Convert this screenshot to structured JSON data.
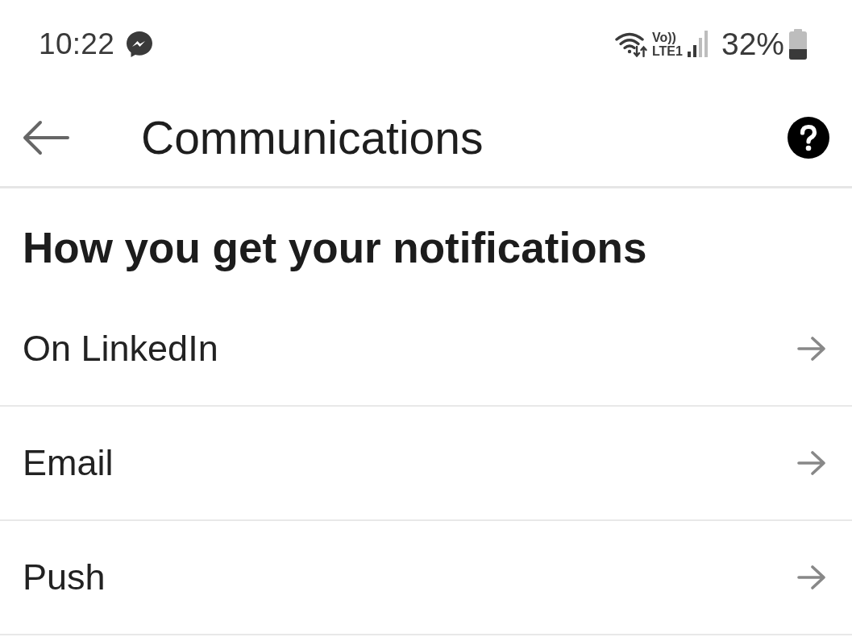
{
  "status_bar": {
    "time": "10:22",
    "network_top": "Vo))",
    "network_bottom": "LTE1",
    "battery": "32%"
  },
  "header": {
    "title": "Communications"
  },
  "section": {
    "heading": "How you get your notifications",
    "items": [
      {
        "label": "On LinkedIn"
      },
      {
        "label": "Email"
      },
      {
        "label": "Push"
      }
    ]
  }
}
